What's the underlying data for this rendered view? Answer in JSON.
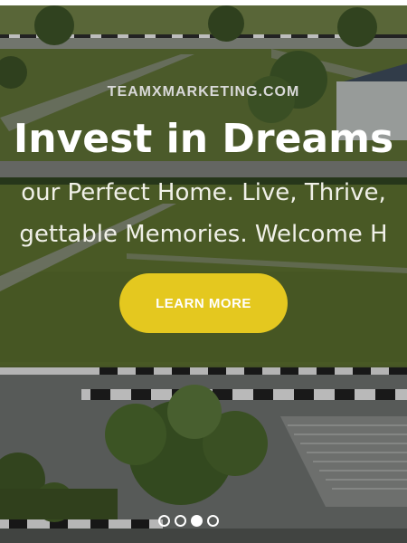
{
  "hero": {
    "site_tag": "TEAMXMARKETING.COM",
    "headline": "Invest in Dreams",
    "subline_1": "our Perfect Home. Live, Thrive,",
    "subline_2": "gettable Memories. Welcome H",
    "cta_label": "LEARN MORE",
    "accent_color": "#e4c81f",
    "background_scene": "aerial-view-housing-development"
  },
  "slider": {
    "slide_count": 4,
    "active_index": 2
  }
}
